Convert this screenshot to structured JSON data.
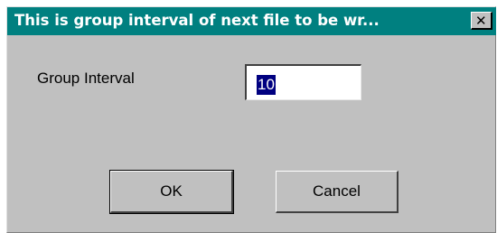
{
  "window": {
    "title": "This is group interval of next file to be wr...",
    "close_glyph": "✕",
    "title_bar_color": "#008080",
    "background_color": "#c0c0c0"
  },
  "form": {
    "label": "Group Interval",
    "value": "10",
    "selection_color": "#000080"
  },
  "buttons": {
    "ok_label": "OK",
    "cancel_label": "Cancel"
  }
}
